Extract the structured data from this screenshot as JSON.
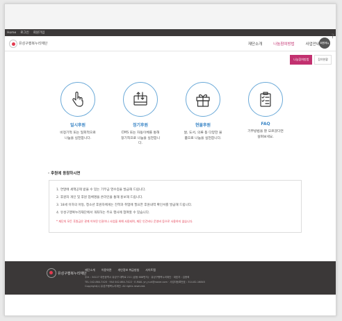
{
  "utility_bar": {
    "items": [
      "Home",
      "로그인",
      "회원가입"
    ]
  },
  "header": {
    "logo_text": "유성구행복누리재단",
    "nav": [
      "재단소개",
      "나눔참여방법",
      "사업안내"
    ],
    "avatar_text": "회원메뉴",
    "help_glyph": "?"
  },
  "subtabs": [
    "나눔참여방법",
    "참여현황"
  ],
  "cards": [
    {
      "icon": "hand-pointing-icon",
      "title": "일시후원",
      "desc": [
        "비정기적 또는 일회적으로",
        "나눔을 실천합니다."
      ]
    },
    {
      "icon": "card-transfer-icon",
      "title": "정기후원",
      "desc": [
        "CMS 또는 자동이체를 통해",
        "정기적으로 나눔을 실천합니",
        "다."
      ]
    },
    {
      "icon": "gift-box-icon",
      "title": "현물후원",
      "desc": [
        "쌀, 도서, 의류 등 다양한 물",
        "품으로 나눔을 실천합니다."
      ]
    },
    {
      "icon": "clipboard-checklist-icon",
      "title": "FAQ",
      "desc": [
        "기부방법을 잘 모르겠다면",
        "살펴보세요."
      ]
    }
  ],
  "section_title": "후원에 동참하시면",
  "notice": {
    "items": [
      "1. 연말에 세액공제 받을 수 있는 기부금 영수증을 발급해 드립니다.",
      "2. 후원자 개인 및 후원 업체명을 온라인을 통해 홍보해 드립니다.",
      "3. 18세 이하의 아동, 청소년 후원자에게는 진학과 취업에 필요한 후원내역 확인서를 발급해 드립니다.",
      "4. 유성구행복누리재단에서 개최하는 주요 행사에 참여할 수 있습니다."
    ],
    "warning": "* 재단의 모든 후원금은 관계 이하된 인권이나 사업을 위해 사용되며, 재단 인건비나 운영비 등으로 사용하지 않습니다."
  },
  "footer": {
    "logo_text": "유성구행복누리재단",
    "links": [
      "재단소개",
      "이용약관",
      "개인정보 취급방침",
      "사이트맵"
    ],
    "address": "주소 : 34127 대전광역시 유성구 대학로 211 (궁동 688번지) · 유성구행복누리재단 · 대표자 : 김종혁",
    "contact": "TEL 042-864-7420 · FAX 042-864-7422 · E-MAIL yn_nuri@naver.com · 사업자등록번호 : 314-82-16845",
    "copyright": "Copyright(c) 유성구행복누리재단. All rights reserved."
  },
  "colors": {
    "accent": "#c2306f",
    "icon_blue": "#3b86c6",
    "footer_bg": "#3b3838"
  }
}
